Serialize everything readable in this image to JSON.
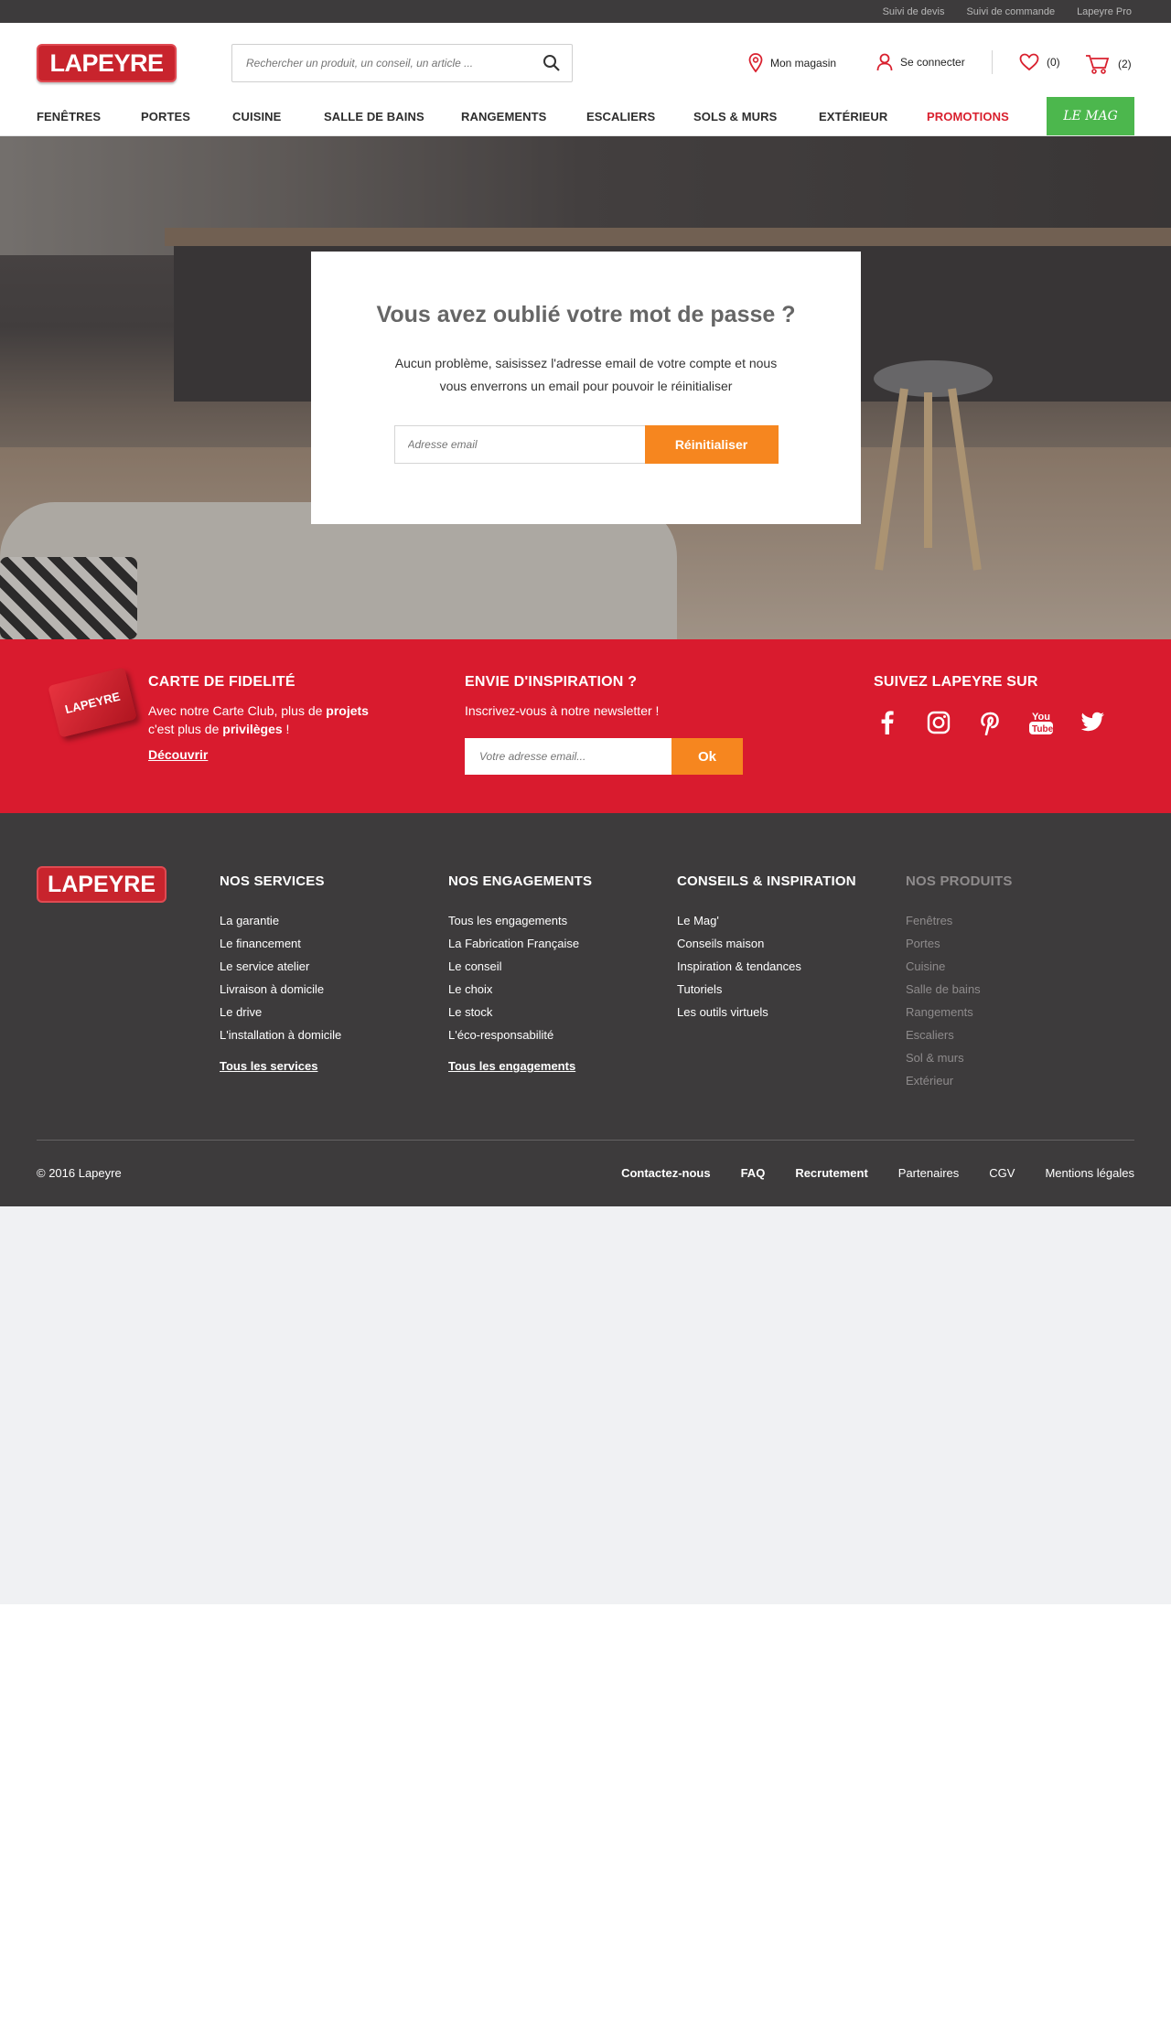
{
  "topbar": {
    "links": [
      "Suivi de devis",
      "Suivi de commande",
      "Lapeyre Pro"
    ]
  },
  "header": {
    "logo": "LAPEYRE",
    "search_placeholder": "Rechercher un produit, un conseil, un article ...",
    "store_label": "Mon magasin",
    "login_label": "Se connecter",
    "wishlist_count": "(0)",
    "cart_count": "(2)"
  },
  "nav": {
    "items": [
      "FENÊTRES",
      "PORTES",
      "CUISINE",
      "SALLE DE BAINS",
      "RANGEMENTS",
      "ESCALIERS",
      "SOLS & MURS",
      "EXTÉRIEUR",
      "PROMOTIONS"
    ],
    "mag_label": "LE MAG"
  },
  "reset": {
    "title": "Vous avez oublié votre mot de passe ?",
    "description": "Aucun problème, saisissez l'adresse email de votre compte et nous vous enverrons un email pour pouvoir le réinitialiser",
    "email_placeholder": "Adresse email",
    "button_label": "Réinitialiser"
  },
  "loyalty": {
    "card_label": "LAPEYRE",
    "title": "CARTE DE FIDELITÉ",
    "text_1": "Avec notre Carte Club, plus de ",
    "text_bold_1": "projets",
    "text_2": "c'est plus de ",
    "text_bold_2": "privilèges",
    "text_3": " !",
    "link": "Découvrir"
  },
  "newsletter": {
    "title": "ENVIE D'INSPIRATION ?",
    "text": "Inscrivez-vous à notre newsletter !",
    "placeholder": "Votre adresse email...",
    "button_label": "Ok"
  },
  "social": {
    "title": "SUIVEZ LAPEYRE SUR",
    "networks": [
      "facebook-icon",
      "instagram-icon",
      "pinterest-icon",
      "youtube-icon",
      "twitter-icon"
    ]
  },
  "footer": {
    "logo": "LAPEYRE",
    "services": {
      "title": "NOS SERVICES",
      "items": [
        "La garantie",
        "Le financement",
        "Le service atelier",
        "Livraison à domicile",
        "Le drive",
        "L'installation à domicile"
      ],
      "more": "Tous les services"
    },
    "engagements": {
      "title": "NOS ENGAGEMENTS",
      "items": [
        "Tous les engagements",
        "La Fabrication Française",
        "Le conseil",
        "Le choix",
        "Le stock",
        "L'éco-responsabilité"
      ],
      "more": "Tous les engagements"
    },
    "conseils": {
      "title": "CONSEILS & INSPIRATION",
      "items": [
        "Le Mag'",
        "Conseils maison",
        "Inspiration & tendances",
        "Tutoriels",
        "Les outils virtuels"
      ]
    },
    "produits": {
      "title": "NOS PRODUITS",
      "items": [
        "Fenêtres",
        "Portes",
        "Cuisine",
        "Salle de bains",
        "Rangements",
        "Escaliers",
        "Sol & murs",
        "Extérieur"
      ]
    },
    "copyright": "© 2016 Lapeyre",
    "bottom_links": [
      "Contactez-nous",
      "FAQ",
      "Recrutement",
      "Partenaires",
      "CGV",
      "Mentions légales"
    ]
  },
  "colors": {
    "brand_red": "#d91b2e",
    "orange": "#f6861f",
    "green": "#4cb74d",
    "dark": "#3d3b3c"
  }
}
